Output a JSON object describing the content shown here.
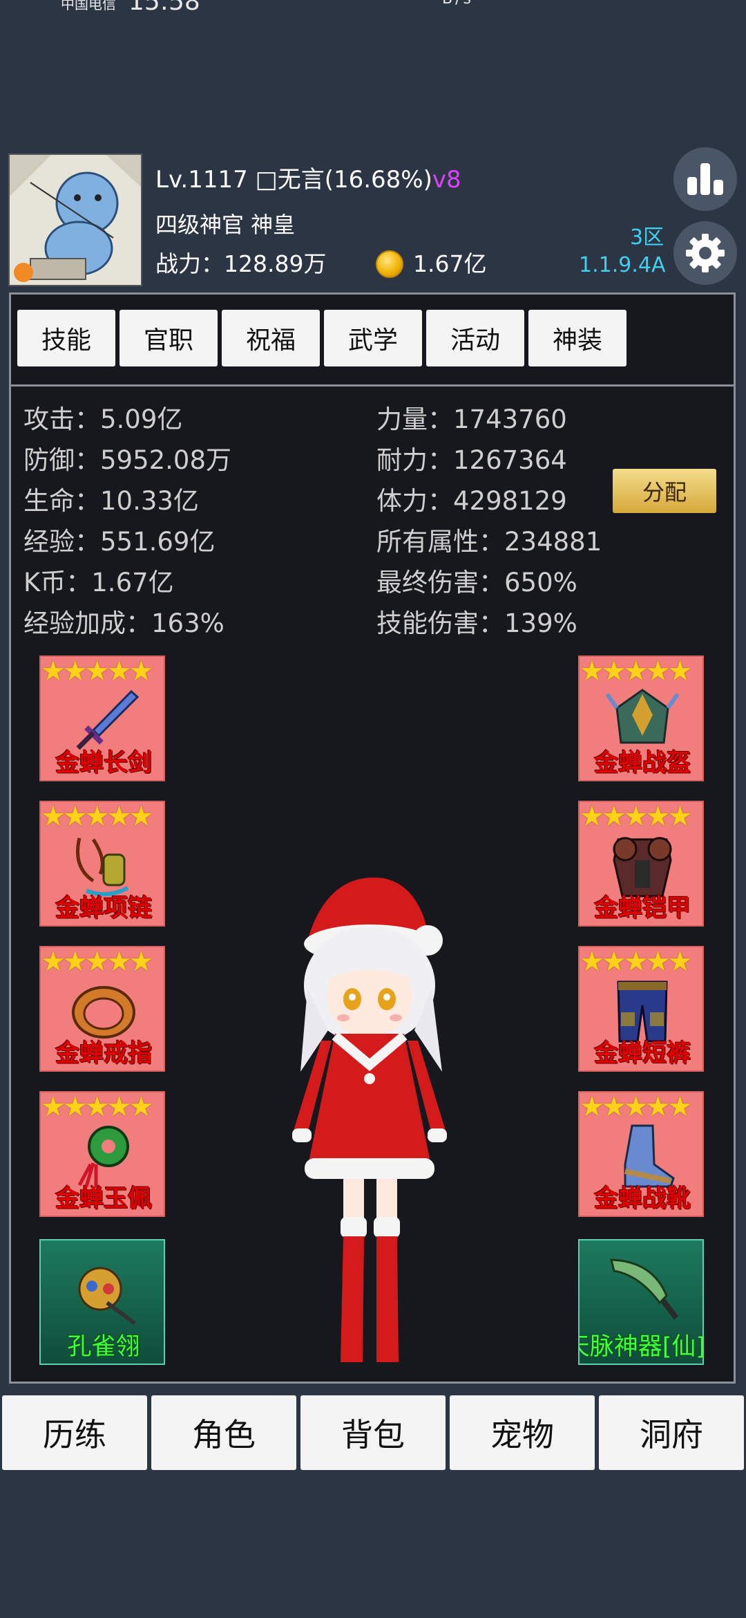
{
  "status_bar": {
    "carrier": "中国电信",
    "time": "15:58",
    "right": "B/s"
  },
  "player": {
    "level": "Lv.1117",
    "name": "□无言(16.68%)",
    "vip": "v8",
    "title": "四级神官 神皇",
    "combat_power": "战力：128.89万",
    "gold": "1.67亿",
    "server": "3区",
    "version": "1.1.9.4A"
  },
  "tabs": [
    "技能",
    "官职",
    "祝福",
    "武学",
    "活动",
    "神装"
  ],
  "stats_left": [
    "攻击：5.09亿",
    "防御：5952.08万",
    "生命：10.33亿",
    "经验：551.69亿",
    "K币：1.67亿",
    "经验加成：163%"
  ],
  "stats_right": [
    "力量：1743760",
    "耐力：1267364",
    "体力：4298129",
    "所有属性：234881",
    "最终伤害：650%",
    "技能伤害：139%"
  ],
  "allocate_label": "分配",
  "stars": "★★★★★",
  "equipment_left": [
    "金蝉长剑",
    "金蝉项链",
    "金蝉戒指",
    "金蝉玉佩",
    "孔雀翎"
  ],
  "equipment_right": [
    "金蝉战盔",
    "金蝉铠甲",
    "金蝉短裤",
    "金蝉战靴",
    "天脉神器[仙]"
  ],
  "nav": [
    "历练",
    "角色",
    "背包",
    "宠物",
    "洞府"
  ],
  "colors": {
    "background": "#2c3544",
    "panel": "#16181d",
    "equip_tile": "#f27d7d",
    "equip_name": "#e00000",
    "special_name": "#3fff3f",
    "version_text": "#3fd0f0",
    "vip": "#e040fb"
  }
}
